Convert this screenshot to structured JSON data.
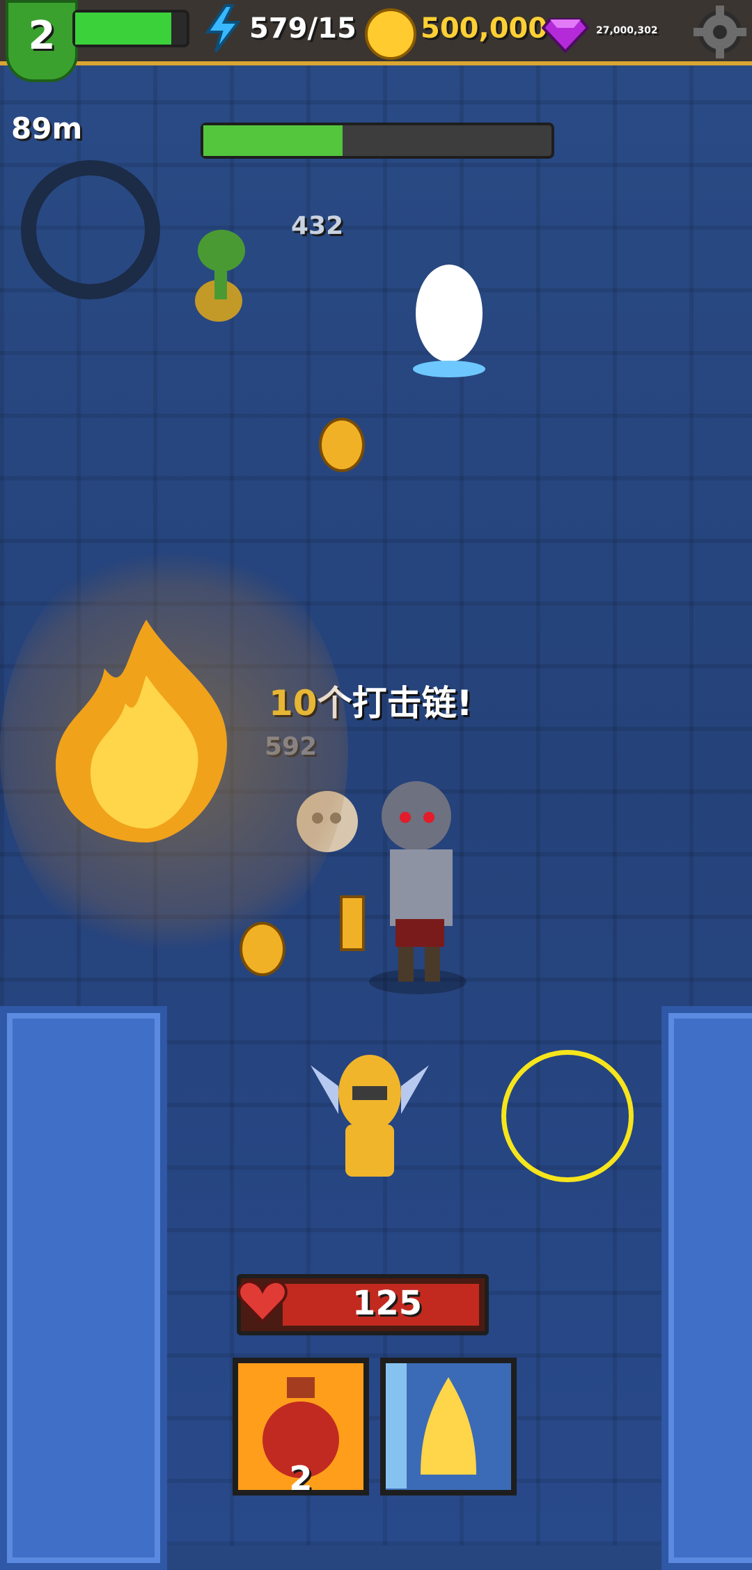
{
  "hud": {
    "level": "2",
    "energy": "579/15",
    "coins": "500,000",
    "gems": "27,000,302",
    "distance": "89m"
  },
  "boss": {
    "health_fraction": 0.4
  },
  "combat": {
    "damage_top": "432",
    "damage_mid": "592",
    "combo_number": "10",
    "combo_text": "个打击链!"
  },
  "player": {
    "hp": "125"
  },
  "skills": {
    "potion_count": "2"
  },
  "colors": {
    "accent_gold": "#ffd035",
    "hp_red": "#c22a1f",
    "energy_green": "#3bd13a"
  }
}
